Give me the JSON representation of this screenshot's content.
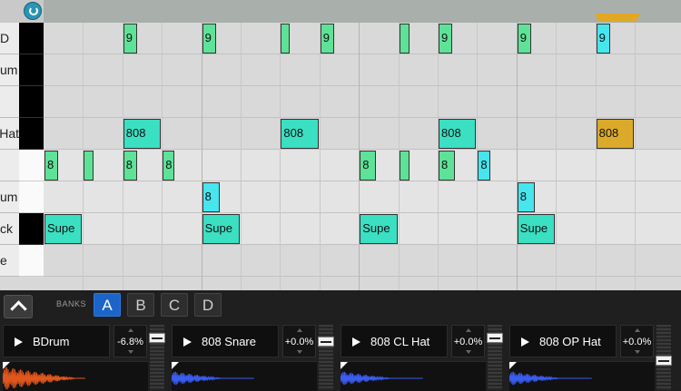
{
  "sequencer": {
    "rows": [
      {
        "label": "D",
        "selector": "black"
      },
      {
        "label": "um",
        "selector": "black"
      },
      {
        "label": "",
        "selector": "black"
      },
      {
        "label": "Hat",
        "selector": "black"
      },
      {
        "label": "",
        "selector": "white",
        "active": true
      },
      {
        "label": "um",
        "selector": "white",
        "active": true
      },
      {
        "label": "ck",
        "selector": "black",
        "active": true
      },
      {
        "label": "e",
        "selector": "white"
      }
    ],
    "clips": [
      {
        "row": 0,
        "step": 2,
        "len": 0.4,
        "label": "9",
        "color": "green"
      },
      {
        "row": 0,
        "step": 4,
        "len": 0.4,
        "label": "9",
        "color": "green"
      },
      {
        "row": 0,
        "step": 6,
        "len": 0.25,
        "label": "",
        "color": "green"
      },
      {
        "row": 0,
        "step": 7,
        "len": 0.4,
        "label": "9",
        "color": "green"
      },
      {
        "row": 0,
        "step": 9,
        "len": 0.3,
        "label": "",
        "color": "green"
      },
      {
        "row": 0,
        "step": 10,
        "len": 0.4,
        "label": "9",
        "color": "green"
      },
      {
        "row": 0,
        "step": 12,
        "len": 0.4,
        "label": "9",
        "color": "green"
      },
      {
        "row": 0,
        "step": 14,
        "len": 0.4,
        "label": "9",
        "color": "cyan"
      },
      {
        "row": 3,
        "step": 2,
        "len": 1,
        "label": "808",
        "color": "teal"
      },
      {
        "row": 3,
        "step": 6,
        "len": 1,
        "label": "808",
        "color": "teal"
      },
      {
        "row": 3,
        "step": 10,
        "len": 1,
        "label": "808",
        "color": "teal"
      },
      {
        "row": 3,
        "step": 14,
        "len": 1,
        "label": "808",
        "color": "gold"
      },
      {
        "row": 4,
        "step": 0,
        "len": 0.4,
        "label": "8",
        "color": "green"
      },
      {
        "row": 4,
        "step": 1,
        "len": 0.3,
        "label": "",
        "color": "green"
      },
      {
        "row": 4,
        "step": 2,
        "len": 0.4,
        "label": "8",
        "color": "green"
      },
      {
        "row": 4,
        "step": 3,
        "len": 0.35,
        "label": "8",
        "color": "green"
      },
      {
        "row": 4,
        "step": 8,
        "len": 0.45,
        "label": "8",
        "color": "green"
      },
      {
        "row": 4,
        "step": 9,
        "len": 0.3,
        "label": "",
        "color": "green"
      },
      {
        "row": 4,
        "step": 10,
        "len": 0.45,
        "label": "8",
        "color": "green"
      },
      {
        "row": 4,
        "step": 11,
        "len": 0.35,
        "label": "8",
        "color": "cyan"
      },
      {
        "row": 5,
        "step": 4,
        "len": 0.5,
        "label": "8",
        "color": "cyan"
      },
      {
        "row": 5,
        "step": 12,
        "len": 0.5,
        "label": "8",
        "color": "cyan"
      },
      {
        "row": 6,
        "step": 0,
        "len": 1,
        "label": "Supe",
        "color": "teal"
      },
      {
        "row": 6,
        "step": 4,
        "len": 1,
        "label": "Supe",
        "color": "teal"
      },
      {
        "row": 6,
        "step": 8,
        "len": 1,
        "label": "Supe",
        "color": "teal"
      },
      {
        "row": 6,
        "step": 12,
        "len": 1,
        "label": "Supe",
        "color": "teal"
      }
    ]
  },
  "banks": {
    "label": "BANKS",
    "items": [
      "A",
      "B",
      "C",
      "D"
    ],
    "active": "A"
  },
  "pads": [
    {
      "name": "BDrum",
      "pitch": "-6.8%",
      "wave_color": "#e0561c",
      "fader_level": 0.85
    },
    {
      "name": "808 Snare",
      "pitch": "+0.0%",
      "wave_color": "#3a5cf0",
      "fader_level": 0.78
    },
    {
      "name": "808 CL Hat",
      "pitch": "+0.0%",
      "wave_color": "#3a5cf0",
      "fader_level": 0.85
    },
    {
      "name": "808 OP Hat",
      "pitch": "+0.0%",
      "wave_color": "#3a5cf0",
      "fader_level": 0.45
    }
  ],
  "icons": {
    "power": "power-icon",
    "collapse": "chevron-up-icon",
    "play": "play-icon"
  }
}
